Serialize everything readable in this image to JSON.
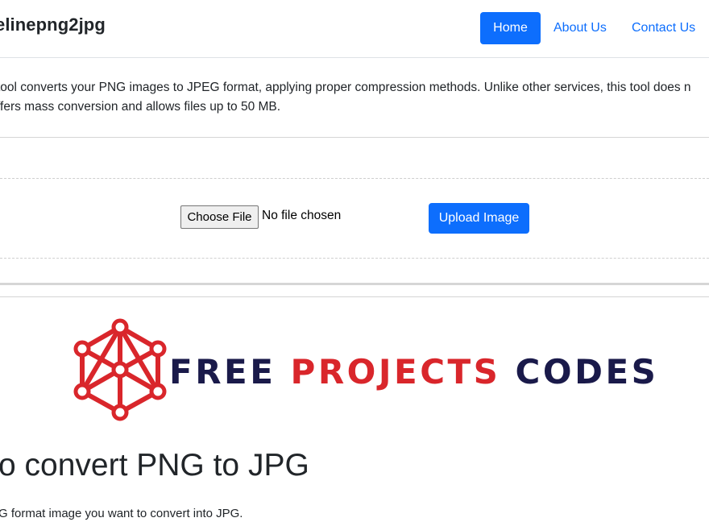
{
  "navbar": {
    "brand": "elinepng2jpg",
    "links": [
      {
        "label": "Home",
        "active": true
      },
      {
        "label": "About Us",
        "active": false
      },
      {
        "label": "Contact Us",
        "active": false
      }
    ]
  },
  "intro": {
    "line1": "tool converts your PNG images to JPEG format, applying proper compression methods. Unlike other services, this tool does n",
    "line2": "ffers mass conversion and allows files up to 50 MB."
  },
  "upload": {
    "choose_label": "Choose File",
    "file_status": "No file chosen",
    "upload_label": "Upload Image"
  },
  "logo": {
    "words": [
      "FREE",
      "PROJECTS",
      "CODES"
    ],
    "colors": {
      "dark": "#1a1a4a",
      "red": "#d9262b"
    }
  },
  "content": {
    "heading": "o convert PNG to JPG",
    "text": "G format image you want to convert into JPG."
  },
  "colors": {
    "primary": "#0d6efd",
    "text": "#212529",
    "border": "#dee2e6"
  }
}
